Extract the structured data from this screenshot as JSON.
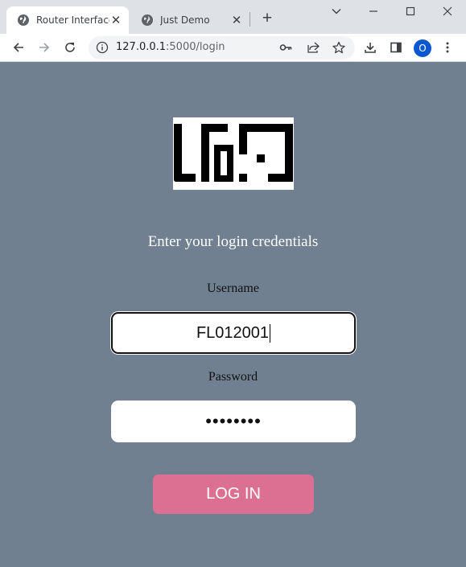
{
  "browser": {
    "tabs": [
      {
        "title": "Router Interface",
        "active": true
      },
      {
        "title": "Just Demo",
        "active": false
      }
    ],
    "new_tab_label": "+",
    "url_host": "127.0.0.1",
    "url_path": ":5000/login",
    "profile_initial": "O"
  },
  "page": {
    "prompt": "Enter your login credentials",
    "username_label": "Username",
    "username_value": "FL012001",
    "password_label": "Password",
    "password_masked": "••••••••",
    "login_button": "LOG IN"
  },
  "colors": {
    "page_background": "#708090",
    "login_button": "#db7093",
    "profile_avatar": "#0b57d0"
  }
}
